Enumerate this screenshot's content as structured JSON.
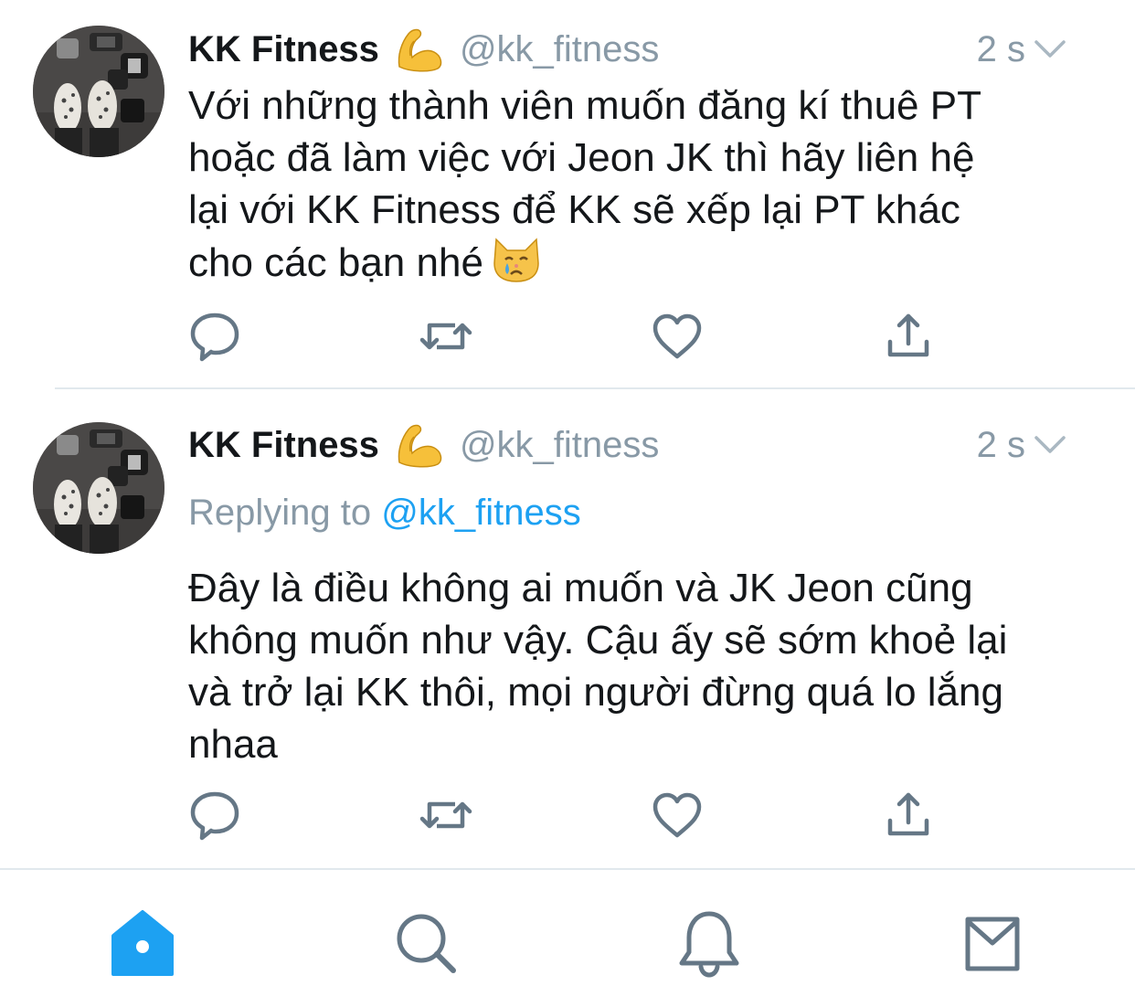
{
  "tweets": [
    {
      "author_name": "KK Fitness",
      "author_emoji": "flexed-biceps",
      "handle": "@kk_fitness",
      "time": "2 s",
      "replying_label": "",
      "replying_handle": "",
      "text_lines": [
        "Với những thành viên muốn đăng kí thuê PT",
        "hoặc đã làm việc với Jeon JK thì hãy liên hệ",
        "lại với KK Fitness để KK sẽ xếp lại PT khác",
        "cho các bạn nhé"
      ],
      "trailing_emoji": "crying-cat-face"
    },
    {
      "author_name": "KK Fitness",
      "author_emoji": "flexed-biceps",
      "handle": "@kk_fitness",
      "time": "2 s",
      "replying_label": "Replying to",
      "replying_handle": "@kk_fitness",
      "text_lines": [
        "Đây là điều không ai muốn và JK Jeon cũng",
        "không muốn như vậy. Cậu ấy sẽ sớm khoẻ lại",
        "và trở lại KK thôi, mọi người đừng quá lo lắng",
        "nhaa"
      ]
    }
  ],
  "actions": [
    "reply-icon",
    "retweet-icon",
    "like-icon",
    "share-icon"
  ],
  "tabbar": {
    "items": [
      "home-icon",
      "search-icon",
      "notifications-icon",
      "messages-icon"
    ],
    "active": "home-icon"
  },
  "colors": {
    "text": "#14171a",
    "secondary": "#8899a6",
    "accent": "#1da1f2",
    "icon": "#657786",
    "divider": "#e1e8ed"
  }
}
